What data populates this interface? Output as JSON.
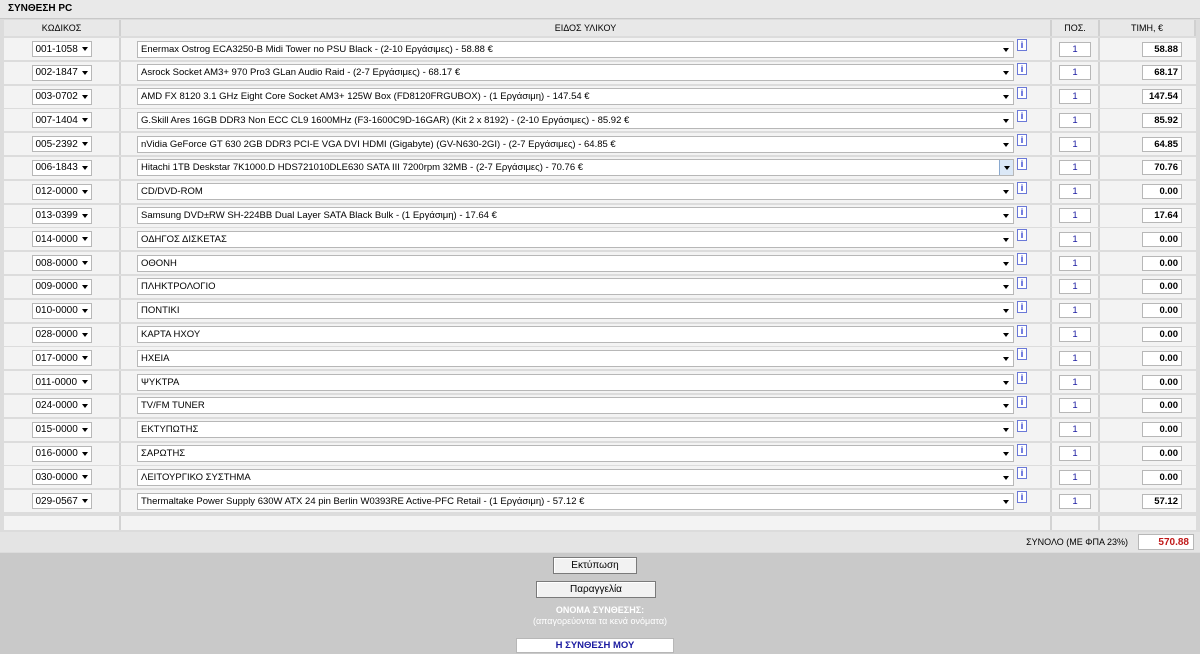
{
  "page_title": "ΣΥΝΘΕΣΗ PC",
  "headers": {
    "code": "ΚΩΔΙΚΟΣ",
    "item": "ΕΙΔΟΣ ΥΛΙΚΟΥ",
    "qty": "ΠΟΣ.",
    "price": "ΤΙΜΗ, €"
  },
  "info_icon_text": "i",
  "rows": [
    {
      "code": "001-1058",
      "item": "Enermax Ostrog ECA3250-B Midi Tower no PSU Black - (2-10 Εργάσιμες) - 58.88 €",
      "qty": "1",
      "price": "58.88"
    },
    {
      "code": "002-1847",
      "item": "Asrock Socket AM3+ 970 Pro3 GLan Audio Raid - (2-7 Εργάσιμες) - 68.17 €",
      "qty": "1",
      "price": "68.17"
    },
    {
      "code": "003-0702",
      "item": "AMD FX 8120 3.1 GHz Eight Core Socket AM3+ 125W Box (FD8120FRGUBOX) - (1 Εργάσιμη) - 147.54 €",
      "qty": "1",
      "price": "147.54"
    },
    {
      "code": "007-1404",
      "item": "G.Skill Ares 16GB DDR3 Non ECC CL9 1600MHz (F3-1600C9D-16GAR) (Kit 2 x 8192) - (2-10 Εργάσιμες) - 85.92 €",
      "qty": "1",
      "price": "85.92"
    },
    {
      "code": "005-2392",
      "item": "nVidia GeForce GT 630 2GB DDR3 PCI-E VGA DVI HDMI (Gigabyte) (GV-N630-2GI) - (2-7 Εργάσιμες) - 64.85 €",
      "qty": "1",
      "price": "64.85"
    },
    {
      "code": "006-1843",
      "item": "Hitachi 1TB Deskstar 7K1000.D HDS721010DLE630 SATA III 7200rpm 32MB - (2-7 Εργάσιμες) - 70.76 €",
      "qty": "1",
      "price": "70.76"
    },
    {
      "code": "012-0000",
      "item": "CD/DVD-ROM",
      "qty": "1",
      "price": "0.00"
    },
    {
      "code": "013-0399",
      "item": "Samsung DVD±RW SH-224BB Dual Layer SATA Black Bulk - (1 Εργάσιμη) - 17.64 €",
      "qty": "1",
      "price": "17.64"
    },
    {
      "code": "014-0000",
      "item": "ΟΔΗΓΟΣ ΔΙΣΚΕΤΑΣ",
      "qty": "1",
      "price": "0.00"
    },
    {
      "code": "008-0000",
      "item": "ΟΘΟΝΗ",
      "qty": "1",
      "price": "0.00"
    },
    {
      "code": "009-0000",
      "item": "ΠΛΗΚΤΡΟΛΟΓΙΟ",
      "qty": "1",
      "price": "0.00"
    },
    {
      "code": "010-0000",
      "item": "ΠΟΝΤΙΚΙ",
      "qty": "1",
      "price": "0.00"
    },
    {
      "code": "028-0000",
      "item": "ΚΑΡΤΑ ΗΧΟΥ",
      "qty": "1",
      "price": "0.00"
    },
    {
      "code": "017-0000",
      "item": "ΗΧΕΙΑ",
      "qty": "1",
      "price": "0.00"
    },
    {
      "code": "011-0000",
      "item": "ΨΥΚΤΡΑ",
      "qty": "1",
      "price": "0.00"
    },
    {
      "code": "024-0000",
      "item": "TV/FM TUNER",
      "qty": "1",
      "price": "0.00"
    },
    {
      "code": "015-0000",
      "item": "ΕΚΤΥΠΩΤΗΣ",
      "qty": "1",
      "price": "0.00"
    },
    {
      "code": "016-0000",
      "item": "ΣΑΡΩΤΗΣ",
      "qty": "1",
      "price": "0.00"
    },
    {
      "code": "030-0000",
      "item": "ΛΕΙΤΟΥΡΓΙΚΟ ΣΥΣΤΗΜΑ",
      "qty": "1",
      "price": "0.00"
    },
    {
      "code": "029-0567",
      "item": "Thermaltake Power Supply 630W ATX 24 pin Berlin W0393RE Active-PFC Retail - (1 Εργάσιμη) - 57.12 €",
      "qty": "1",
      "price": "57.12"
    }
  ],
  "total": {
    "label": "ΣΥΝΟΛΟ (ΜΕ ΦΠΑ 23%)",
    "value": "570.88"
  },
  "buttons": {
    "print": "Εκτύπωση",
    "order": "Παραγγελία"
  },
  "name_section": {
    "title": "ΟΝΟΜΑ ΣΥΝΘΕΣΗΣ:",
    "note": "(απαγορεύονται τα κενά ονόματα)",
    "value": "Η ΣΥΝΘΕΣΗ ΜΟΥ"
  }
}
